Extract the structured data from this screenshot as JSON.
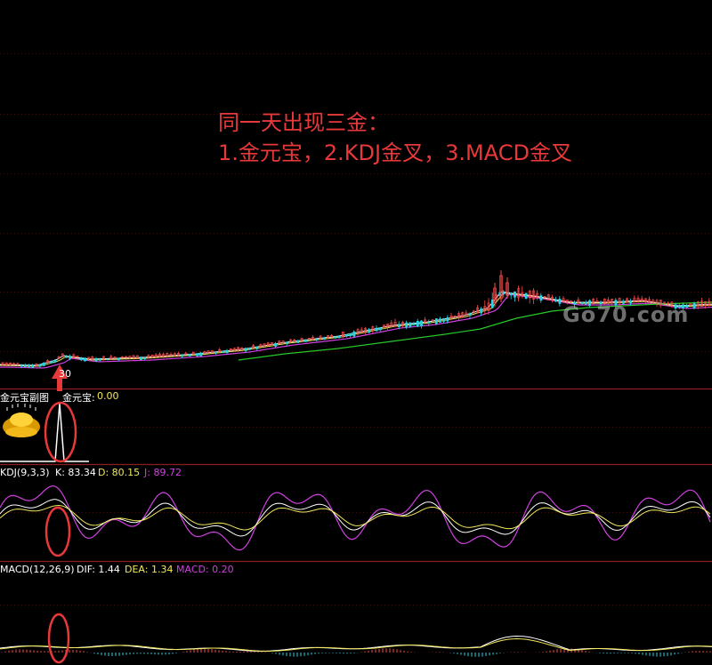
{
  "annotation": {
    "line1": "同一天出现三金：",
    "line2": "1.金元宝，2.KDJ金叉，3.MACD金叉"
  },
  "watermark": "Go70.com",
  "main_panel": {
    "marker_label": "30"
  },
  "jyb_panel": {
    "title": "金元宝副图",
    "value_name": "金元宝:",
    "value": "0.00"
  },
  "kdj_panel": {
    "title": "KDJ(9,3,3)",
    "k_label": "K: 83.34",
    "d_label": "D: 80.15",
    "j_label": "J: 89.72"
  },
  "macd_panel": {
    "title": "MACD(12,26,9)",
    "dif_label": "DIF: 1.44",
    "dea_label": "DEA: 1.34",
    "macd_label": "MACD: 0.20"
  },
  "colors": {
    "background": "#000000",
    "annotation": "#e8393a",
    "separator": "#8a1d1d",
    "grid": "#3a0c0c",
    "up": "#ff4a4a",
    "down": "#22d6e6",
    "k_line": "#ffffff",
    "d_line": "#f2e85a",
    "j_line": "#d040e0",
    "ma_long": "#28c828",
    "highlight_ellipse": "#e8393a",
    "arrow": "#e8393a"
  },
  "icons": {
    "ingot": "gold-ingot-icon",
    "arrow": "arrow-up-icon"
  }
}
